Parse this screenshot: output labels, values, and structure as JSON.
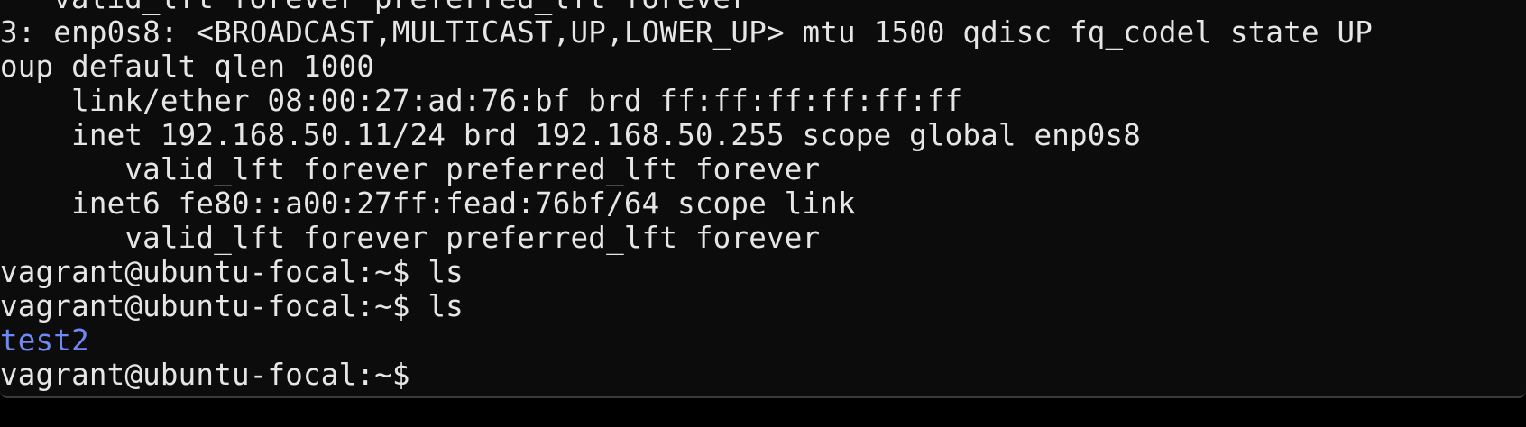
{
  "terminal": {
    "lines": [
      {
        "text": "    valid_lft forever preferred_lft forever",
        "kind": "output"
      },
      {
        "text": "3: enp0s8: <BROADCAST,MULTICAST,UP,LOWER_UP> mtu 1500 qdisc fq_codel state UP",
        "kind": "output"
      },
      {
        "text": "oup default qlen 1000",
        "kind": "output"
      },
      {
        "text": "    link/ether 08:00:27:ad:76:bf brd ff:ff:ff:ff:ff:ff",
        "kind": "output"
      },
      {
        "text": "    inet 192.168.50.11/24 brd 192.168.50.255 scope global enp0s8",
        "kind": "output"
      },
      {
        "text": "       valid_lft forever preferred_lft forever",
        "kind": "output"
      },
      {
        "text": "    inet6 fe80::a00:27ff:fead:76bf/64 scope link",
        "kind": "output"
      },
      {
        "text": "       valid_lft forever preferred_lft forever",
        "kind": "output"
      },
      {
        "text": "vagrant@ubuntu-focal:~$ ls",
        "kind": "command"
      },
      {
        "text": "vagrant@ubuntu-focal:~$ ls",
        "kind": "command"
      },
      {
        "text": "test2",
        "kind": "directory"
      },
      {
        "text": "vagrant@ubuntu-focal:~$ ",
        "kind": "prompt"
      }
    ]
  },
  "colors": {
    "background": "#0c0c0c",
    "foreground": "#e6e6e6",
    "directory": "#6f88f5"
  }
}
